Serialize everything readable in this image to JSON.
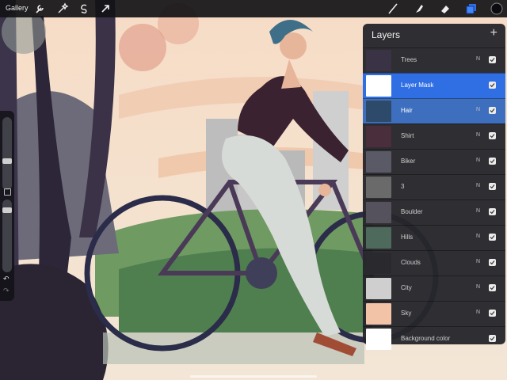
{
  "topbar": {
    "gallery_label": "Gallery",
    "left_tools": [
      "wrench-icon",
      "magic-wand-icon",
      "selection-icon",
      "transform-arrow-icon"
    ],
    "right_tools": [
      "brush-icon",
      "smudge-icon",
      "eraser-icon",
      "layers-icon",
      "color-swatch-icon"
    ],
    "active_color": "#0b0b10",
    "accent": "#2f6ee3"
  },
  "sidebar": {
    "tools": [
      "brush-size-slider",
      "modify-button",
      "opacity-slider",
      "undo-icon",
      "redo-icon"
    ]
  },
  "layers_panel": {
    "title": "Layers",
    "add_label": "+",
    "layers": [
      {
        "name": "Trees",
        "blend": "N",
        "visible": true,
        "state": "normal",
        "thumb": "#3a3346"
      },
      {
        "name": "Layer Mask",
        "blend": "",
        "visible": true,
        "state": "selected",
        "thumb": "#ffffff"
      },
      {
        "name": "Hair",
        "blend": "N",
        "visible": true,
        "state": "secondary",
        "thumb": "#2e4a6a"
      },
      {
        "name": "Shirt",
        "blend": "N",
        "visible": true,
        "state": "normal",
        "thumb": "#4a2e3c"
      },
      {
        "name": "Biker",
        "blend": "N",
        "visible": true,
        "state": "normal",
        "thumb": "#5a5a66"
      },
      {
        "name": "3",
        "blend": "N",
        "visible": true,
        "state": "normal",
        "thumb": "#6a6a6a"
      },
      {
        "name": "Boulder",
        "blend": "N",
        "visible": true,
        "state": "normal",
        "thumb": "#55525e"
      },
      {
        "name": "Hills",
        "blend": "N",
        "visible": true,
        "state": "normal",
        "thumb": "#4e6a5c"
      },
      {
        "name": "Clouds",
        "blend": "N",
        "visible": true,
        "state": "normal",
        "thumb": "#2a2a2e"
      },
      {
        "name": "City",
        "blend": "N",
        "visible": true,
        "state": "normal",
        "thumb": "#cfcfcf"
      },
      {
        "name": "Sky",
        "blend": "N",
        "visible": true,
        "state": "normal",
        "thumb": "#f3c3a8"
      },
      {
        "name": "Background color",
        "blend": "",
        "visible": true,
        "state": "normal",
        "thumb": "#ffffff"
      }
    ]
  }
}
